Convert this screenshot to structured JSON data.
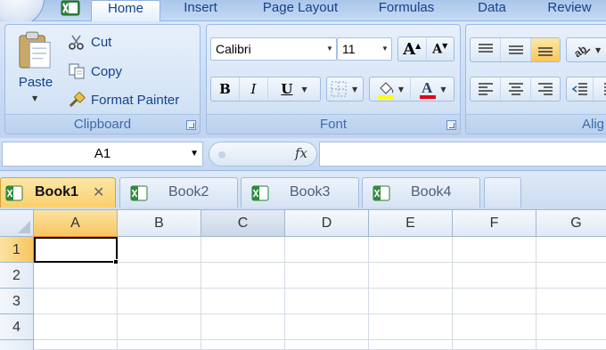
{
  "ribbon": {
    "tabs": [
      "Home",
      "Insert",
      "Page Layout",
      "Formulas",
      "Data",
      "Review"
    ],
    "active_tab": "Home"
  },
  "clipboard": {
    "paste_label": "Paste",
    "cut_label": "Cut",
    "copy_label": "Copy",
    "format_painter_label": "Format Painter",
    "group_label": "Clipboard"
  },
  "font": {
    "family": "Calibri",
    "size": "11",
    "group_label": "Font",
    "highlight_color": "#ffff00",
    "font_color": "#e3001b"
  },
  "alignment": {
    "group_label": "Alig"
  },
  "formula_bar": {
    "name_box": "A1",
    "fx_label": "fx",
    "formula": ""
  },
  "workbooks": [
    {
      "name": "Book1",
      "active": true,
      "close_glyph": "✕"
    },
    {
      "name": "Book2",
      "active": false
    },
    {
      "name": "Book3",
      "active": false
    },
    {
      "name": "Book4",
      "active": false
    }
  ],
  "sheet": {
    "columns": [
      "A",
      "B",
      "C",
      "D",
      "E",
      "F",
      "G"
    ],
    "rows": [
      "1",
      "2",
      "3",
      "4"
    ],
    "active_cell": "A1"
  }
}
